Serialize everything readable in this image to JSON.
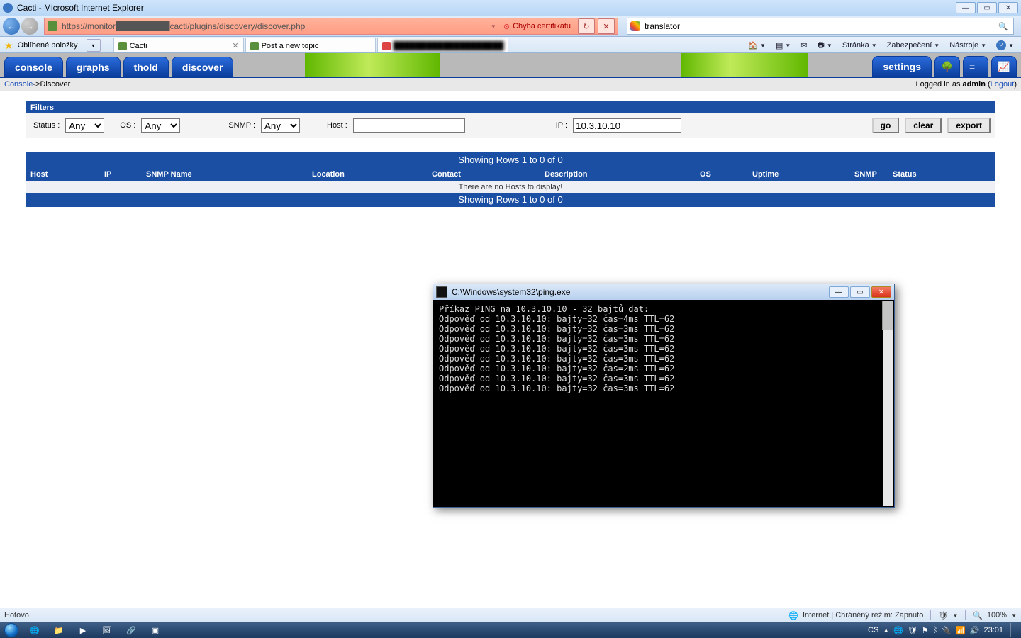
{
  "window": {
    "title": "Cacti - Microsoft Internet Explorer"
  },
  "nav": {
    "url": "https://monitor█████████cacti/plugins/discovery/discover.php"
  },
  "cert_error": {
    "text": "Chyba certifikátu"
  },
  "search": {
    "placeholder": "translator"
  },
  "favorites_label": "Oblíbené položky",
  "tabs": [
    {
      "label": "Cacti"
    },
    {
      "label": "Post a new topic"
    },
    {
      "label": "████████████████████"
    }
  ],
  "ie_menus": {
    "pages": "Stránka",
    "safety": "Zabezpečení",
    "tools": "Nástroje"
  },
  "cacti": {
    "tabs": {
      "console": "console",
      "graphs": "graphs",
      "thold": "thold",
      "discover": "discover",
      "settings": "settings"
    },
    "breadcrumb": {
      "root": "Console",
      "sep": " -> ",
      "leaf": "Discover"
    },
    "login": {
      "prefix": "Logged in as ",
      "user": "admin",
      "logout": "Logout"
    },
    "filters": {
      "title": "Filters",
      "status_label": "Status :",
      "status_value": "Any",
      "os_label": "OS :",
      "os_value": "Any",
      "snmp_label": "SNMP :",
      "snmp_value": "Any",
      "host_label": "Host :",
      "host_value": "",
      "ip_label": "IP :",
      "ip_value": "10.3.10.10",
      "go": "go",
      "clear": "clear",
      "export": "export"
    },
    "results": {
      "pager": "Showing Rows 1 to 0 of 0",
      "cols": {
        "host": "Host",
        "ip": "IP",
        "snmp": "SNMP Name",
        "loc": "Location",
        "con": "Contact",
        "desc": "Description",
        "os": "OS",
        "up": "Uptime",
        "snmp2": "SNMP",
        "stat": "Status"
      },
      "empty": "There are no Hosts to display!"
    }
  },
  "cmd": {
    "title": "C:\\Windows\\system32\\ping.exe",
    "lines": [
      "Příkaz PING na 10.3.10.10 - 32 bajtů dat:",
      "Odpověď od 10.3.10.10: bajty=32 čas=4ms TTL=62",
      "Odpověď od 10.3.10.10: bajty=32 čas=3ms TTL=62",
      "Odpověď od 10.3.10.10: bajty=32 čas=3ms TTL=62",
      "Odpověď od 10.3.10.10: bajty=32 čas=3ms TTL=62",
      "Odpověď od 10.3.10.10: bajty=32 čas=3ms TTL=62",
      "Odpověď od 10.3.10.10: bajty=32 čas=2ms TTL=62",
      "Odpověď od 10.3.10.10: bajty=32 čas=3ms TTL=62",
      "Odpověď od 10.3.10.10: bajty=32 čas=3ms TTL=62"
    ]
  },
  "ie_status": {
    "left": "Hotovo",
    "zone": "Internet | Chráněný režim: Zapnuto",
    "zoom": "100%"
  },
  "taskbar": {
    "lang": "CS",
    "clock": "23:01"
  }
}
